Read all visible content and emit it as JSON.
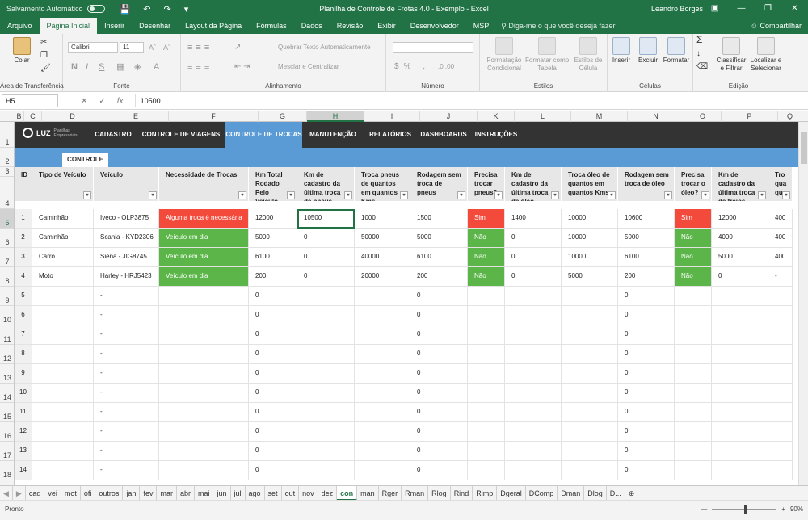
{
  "titlebar": {
    "autosave": "Salvamento Automático",
    "title": "Planilha de Controle de Frotas 4.0 - Exemplo  -  Excel",
    "user": "Leandro Borges"
  },
  "ribbon_tabs": [
    "Arquivo",
    "Página Inicial",
    "Inserir",
    "Desenhar",
    "Layout da Página",
    "Fórmulas",
    "Dados",
    "Revisão",
    "Exibir",
    "Desenvolvedor",
    "MSP"
  ],
  "active_ribbon_tab": "Página Inicial",
  "tell_me": "Diga-me o que você deseja fazer",
  "share": "Compartilhar",
  "ribbon": {
    "paste": "Colar",
    "clipboard": "Área de Transferência",
    "font_name": "Calibri",
    "font_size": "11",
    "font": "Fonte",
    "wrap": "Quebrar Texto Automaticamente",
    "merge": "Mesclar e Centralizar",
    "alignment": "Alinhamento",
    "number": "Número",
    "cond_format_1": "Formatação",
    "cond_format_2": "Condicional",
    "format_table_1": "Formatar como",
    "format_table_2": "Tabela",
    "cell_styles_1": "Estilos de",
    "cell_styles_2": "Célula",
    "styles": "Estilos",
    "insert": "Inserir",
    "delete": "Excluir",
    "format": "Formatar",
    "cells": "Células",
    "sort_1": "Classificar",
    "sort_2": "e Filtrar",
    "find_1": "Localizar e",
    "find_2": "Selecionar",
    "editing": "Edição"
  },
  "formula_bar": {
    "name_box": "H5",
    "value": "10500"
  },
  "columns": [
    "B",
    "C",
    "D",
    "E",
    "F",
    "G",
    "H",
    "I",
    "J",
    "K",
    "L",
    "M",
    "N",
    "O",
    "P",
    "Q"
  ],
  "selected_column": "H",
  "row_numbers": [
    "1",
    "2",
    "3",
    "4",
    "5",
    "6",
    "7",
    "8",
    "9",
    "10",
    "11",
    "12",
    "13",
    "14",
    "15",
    "16",
    "17",
    "18"
  ],
  "nav": [
    "CADASTRO",
    "CONTROLE DE VIAGENS",
    "CONTROLE DE TROCAS",
    "MANUTENÇÃO",
    "RELATÓRIOS",
    "DASHBOARDS",
    "INSTRUÇÕES"
  ],
  "active_nav": "CONTROLE DE TROCAS",
  "logo": {
    "text": "LUZ",
    "sub1": "Planilhas",
    "sub2": "Empresariais"
  },
  "controle_tab": "CONTROLE",
  "table": {
    "headers": [
      "ID",
      "Tipo de Veículo",
      "Veículo",
      "Necessidade de Trocas",
      "Km Total Rodado Pelo Veículo",
      "Km de cadastro da última troca de pneus",
      "Troca pneus de quantos em quantos Kms",
      "Rodagem sem troca de pneus",
      "Precisa trocar pneus?",
      "Km de cadastro da última troca de óleo",
      "Troca óleo de quantos em quantos Kms",
      "Rodagem sem troca de óleo",
      "Precisa trocar o óleo?",
      "Km de cadastro da última troca de freios",
      "Tro qua qu"
    ],
    "rows": [
      [
        "1",
        "Caminhão",
        "Iveco - OLP3875",
        "Alguma troca é necessária",
        "12000",
        "10500",
        "1000",
        "1500",
        "Sim",
        "1400",
        "10000",
        "10600",
        "Sim",
        "12000",
        "400"
      ],
      [
        "2",
        "Caminhão",
        "Scania - KYD2306",
        "Veículo em dia",
        "5000",
        "0",
        "50000",
        "5000",
        "Não",
        "0",
        "10000",
        "5000",
        "Não",
        "4000",
        "400"
      ],
      [
        "3",
        "Carro",
        "Siena - JIG8745",
        "Veículo em dia",
        "6100",
        "0",
        "40000",
        "6100",
        "Não",
        "0",
        "10000",
        "6100",
        "Não",
        "5000",
        "400"
      ],
      [
        "4",
        "Moto",
        "Harley - HRJ5423",
        "Veículo em dia",
        "200",
        "0",
        "20000",
        "200",
        "Não",
        "0",
        "5000",
        "200",
        "Não",
        "0",
        "-"
      ],
      [
        "5",
        "",
        "-",
        "",
        "0",
        "",
        "",
        "0",
        "",
        "",
        "",
        "0",
        "",
        "",
        ""
      ],
      [
        "6",
        "",
        "-",
        "",
        "0",
        "",
        "",
        "0",
        "",
        "",
        "",
        "0",
        "",
        "",
        ""
      ],
      [
        "7",
        "",
        "-",
        "",
        "0",
        "",
        "",
        "0",
        "",
        "",
        "",
        "0",
        "",
        "",
        ""
      ],
      [
        "8",
        "",
        "-",
        "",
        "0",
        "",
        "",
        "0",
        "",
        "",
        "",
        "0",
        "",
        "",
        ""
      ],
      [
        "9",
        "",
        "-",
        "",
        "0",
        "",
        "",
        "0",
        "",
        "",
        "",
        "0",
        "",
        "",
        ""
      ],
      [
        "10",
        "",
        "-",
        "",
        "0",
        "",
        "",
        "0",
        "",
        "",
        "",
        "0",
        "",
        "",
        ""
      ],
      [
        "11",
        "",
        "-",
        "",
        "0",
        "",
        "",
        "0",
        "",
        "",
        "",
        "0",
        "",
        "",
        ""
      ],
      [
        "12",
        "",
        "-",
        "",
        "0",
        "",
        "",
        "0",
        "",
        "",
        "",
        "0",
        "",
        "",
        ""
      ],
      [
        "13",
        "",
        "-",
        "",
        "0",
        "",
        "",
        "0",
        "",
        "",
        "",
        "0",
        "",
        "",
        ""
      ],
      [
        "14",
        "",
        "-",
        "",
        "0",
        "",
        "",
        "0",
        "",
        "",
        "",
        "0",
        "",
        "",
        ""
      ]
    ],
    "status_colors": {
      "Sim": "#f44a3b",
      "Não": "#5bb548",
      "Alguma troca é necessária": "#f44a3b",
      "Veículo em dia": "#5bb548"
    }
  },
  "sheet_tabs": [
    "cad",
    "vei",
    "mot",
    "ofi",
    "outros",
    "jan",
    "fev",
    "mar",
    "abr",
    "mai",
    "jun",
    "jul",
    "ago",
    "set",
    "out",
    "nov",
    "dez",
    "con",
    "man",
    "Rger",
    "Rman",
    "Rlog",
    "Rind",
    "Rimp",
    "Dgeral",
    "DComp",
    "Dman",
    "Dlog",
    "D..."
  ],
  "active_sheet": "con",
  "status": {
    "ready": "Pronto",
    "zoom": "90%"
  },
  "colors": {
    "excel_green": "#217346",
    "nav_dark": "#333333",
    "accent_blue": "#5b9bd5"
  }
}
